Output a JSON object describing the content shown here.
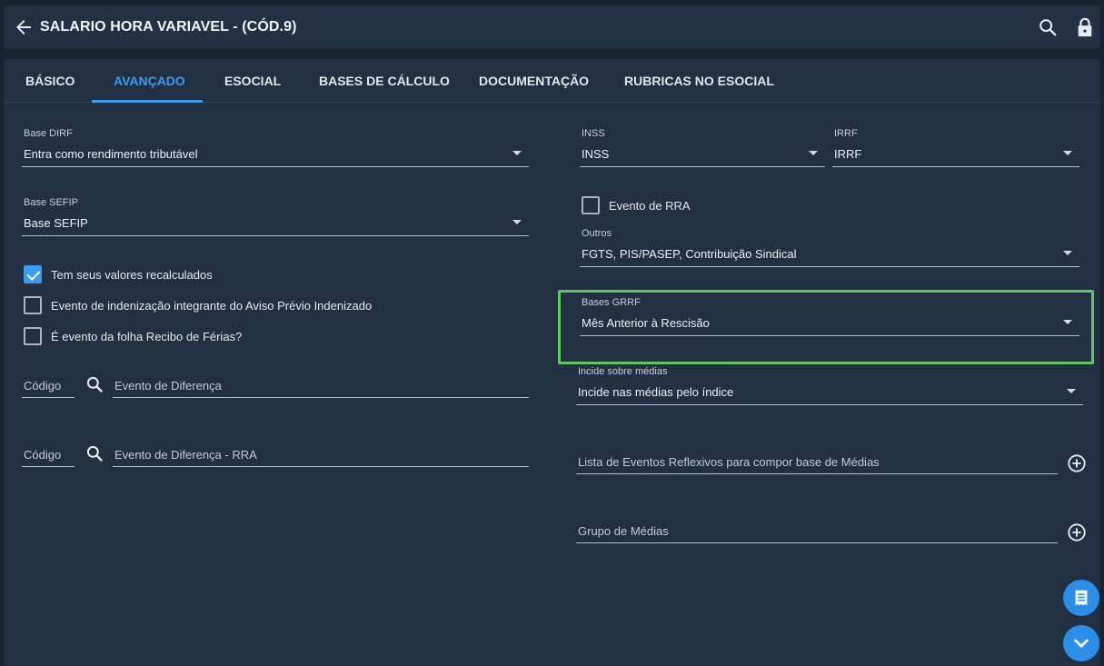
{
  "header": {
    "title": "SALARIO HORA VARIAVEL - (CÓD.9)",
    "icons": [
      "arrow-back-icon",
      "search-icon",
      "lock-icon"
    ]
  },
  "tabs": [
    {
      "label": "BÁSICO",
      "active": false
    },
    {
      "label": "AVANÇADO",
      "active": true
    },
    {
      "label": "ESOCIAL",
      "active": false
    },
    {
      "label": "BASES DE CÁLCULO",
      "active": false
    },
    {
      "label": "DOCUMENTAÇÃO",
      "active": false
    },
    {
      "label": "RUBRICAS NO ESOCIAL",
      "active": false
    }
  ],
  "left": {
    "base_dirf": {
      "label": "Base DIRF",
      "value": "Entra como rendimento tributável"
    },
    "base_sefip": {
      "label": "Base SEFIP",
      "value": "Base SEFIP"
    },
    "checks": [
      {
        "label": "Tem seus valores recalculados",
        "checked": true
      },
      {
        "label": "Evento de indenização integrante do Aviso Prévio Indenizado",
        "checked": false
      },
      {
        "label": "É evento da folha Recibo de Férias?",
        "checked": false
      }
    ],
    "diferenca": {
      "codigo_placeholder": "Código",
      "evento_placeholder": "Evento de Diferença"
    },
    "diferenca_rra": {
      "codigo_placeholder": "Código",
      "evento_placeholder": "Evento de Diferença - RRA"
    }
  },
  "right": {
    "inss": {
      "label": "INSS",
      "value": "INSS"
    },
    "irrf": {
      "label": "IRRF",
      "value": "IRRF"
    },
    "evento_rra": {
      "label": "Evento de RRA",
      "checked": false
    },
    "outros": {
      "label": "Outros",
      "value": "FGTS, PIS/PASEP, Contribuição Sindical"
    },
    "bases_grrf": {
      "label": "Bases GRRF",
      "value": "Mês Anterior à Rescisão"
    },
    "incide_medias": {
      "label": "Incide sobre médias",
      "value": "Incide nas médias pelo índice"
    },
    "lista_eventos": {
      "placeholder": "Lista de Eventos Reflexivos para compor base de Médias"
    },
    "grupo_medias": {
      "placeholder": "Grupo de Médias"
    }
  },
  "colors": {
    "accent": "#3c9cf0",
    "highlight": "#5ec964",
    "background": "#223042"
  }
}
